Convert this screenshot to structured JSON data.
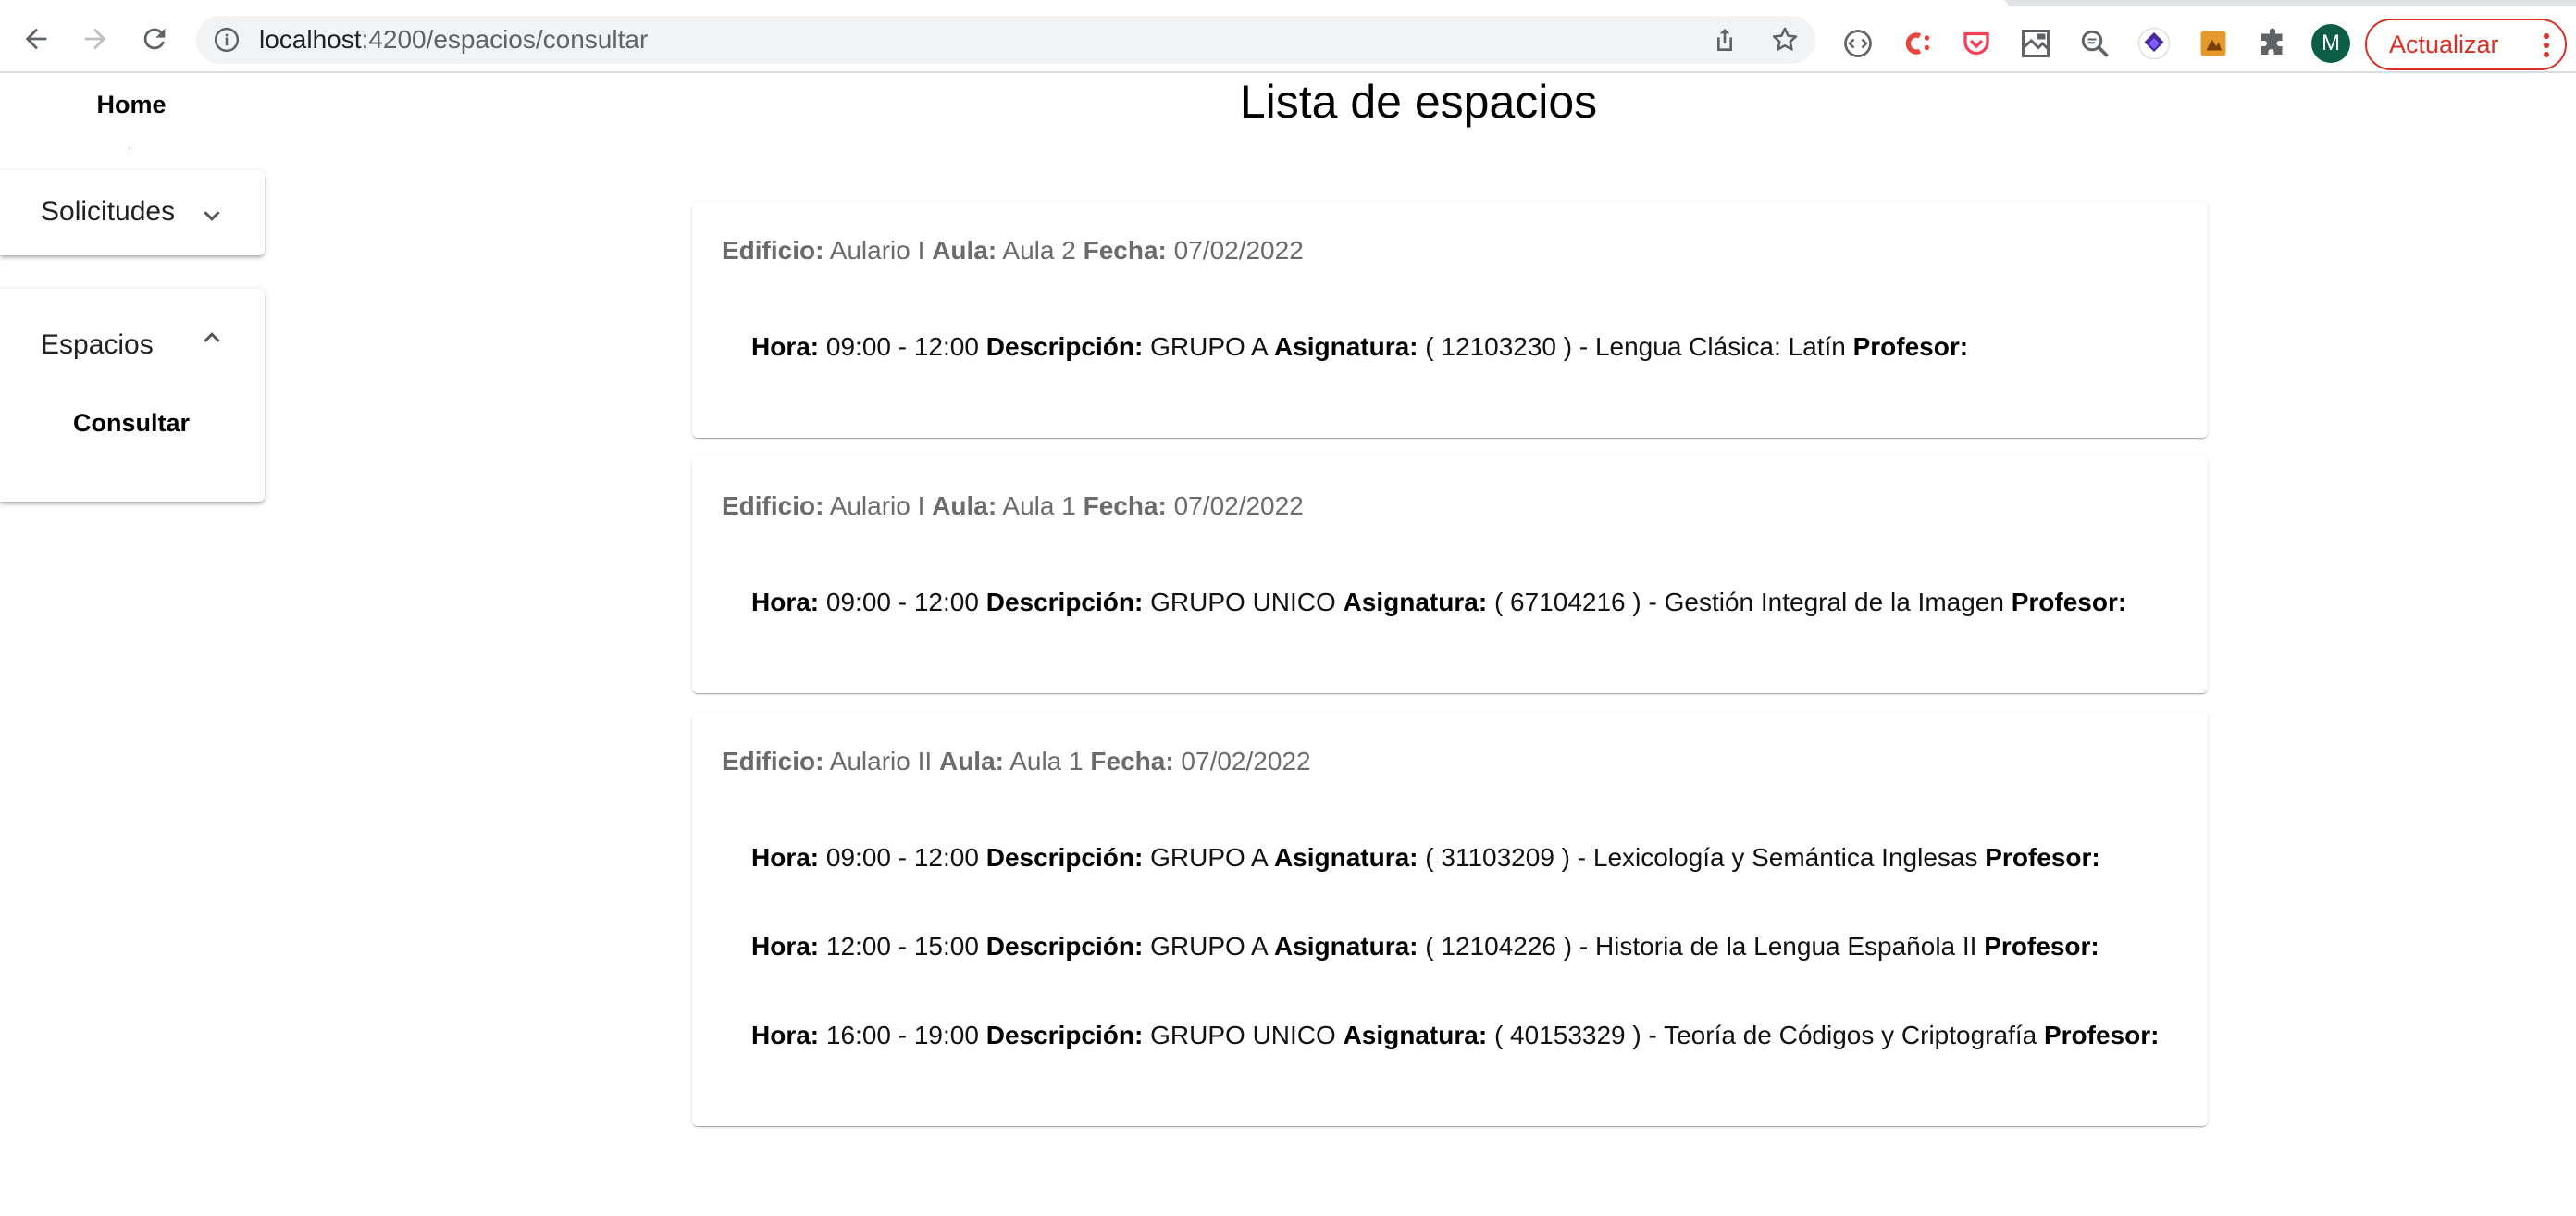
{
  "browser": {
    "url_host": "localhost",
    "url_rest": ":4200/espacios/consultar",
    "avatar_letter": "M",
    "update_label": "Actualizar",
    "extensions": [
      "code-ext-icon",
      "c-ext-icon",
      "pocket-icon",
      "image-ext-icon",
      "search-ext-icon",
      "layers-ext-icon",
      "orange-ext-icon",
      "puzzle-icon"
    ]
  },
  "sidebar": {
    "home": "Home",
    "mark": "'",
    "solicitudes": "Solicitudes",
    "espacios": "Espacios",
    "consultar": "Consultar"
  },
  "main": {
    "title": "Lista de espacios",
    "labels": {
      "edificio": "Edificio:",
      "aula": "Aula:",
      "fecha": "Fecha:",
      "hora": "Hora:",
      "descripcion": "Descripción:",
      "asignatura": "Asignatura:",
      "profesor": "Profesor:"
    },
    "cards": [
      {
        "edificio": "Aulario I",
        "aula": "Aula 2",
        "fecha": "07/02/2022",
        "entries": [
          {
            "hora": "09:00 - 12:00",
            "descripcion": "GRUPO A",
            "asignatura": "( 12103230 ) - Lengua Clásica: Latín",
            "profesor": ""
          }
        ]
      },
      {
        "edificio": "Aulario I",
        "aula": "Aula 1",
        "fecha": "07/02/2022",
        "entries": [
          {
            "hora": "09:00 - 12:00",
            "descripcion": "GRUPO UNICO",
            "asignatura": "( 67104216 ) - Gestión Integral de la Imagen",
            "profesor": ""
          }
        ]
      },
      {
        "edificio": "Aulario II",
        "aula": "Aula 1",
        "fecha": "07/02/2022",
        "entries": [
          {
            "hora": "09:00 - 12:00",
            "descripcion": "GRUPO A",
            "asignatura": "( 31103209 ) - Lexicología y Semántica Inglesas",
            "profesor": ""
          },
          {
            "hora": "12:00 - 15:00",
            "descripcion": "GRUPO A",
            "asignatura": "( 12104226 ) - Historia de la Lengua Española II",
            "profesor": ""
          },
          {
            "hora": "16:00 - 19:00",
            "descripcion": "GRUPO UNICO",
            "asignatura": "( 40153329 ) - Teoría de Códigos y Criptografía",
            "profesor": ""
          }
        ]
      }
    ]
  }
}
